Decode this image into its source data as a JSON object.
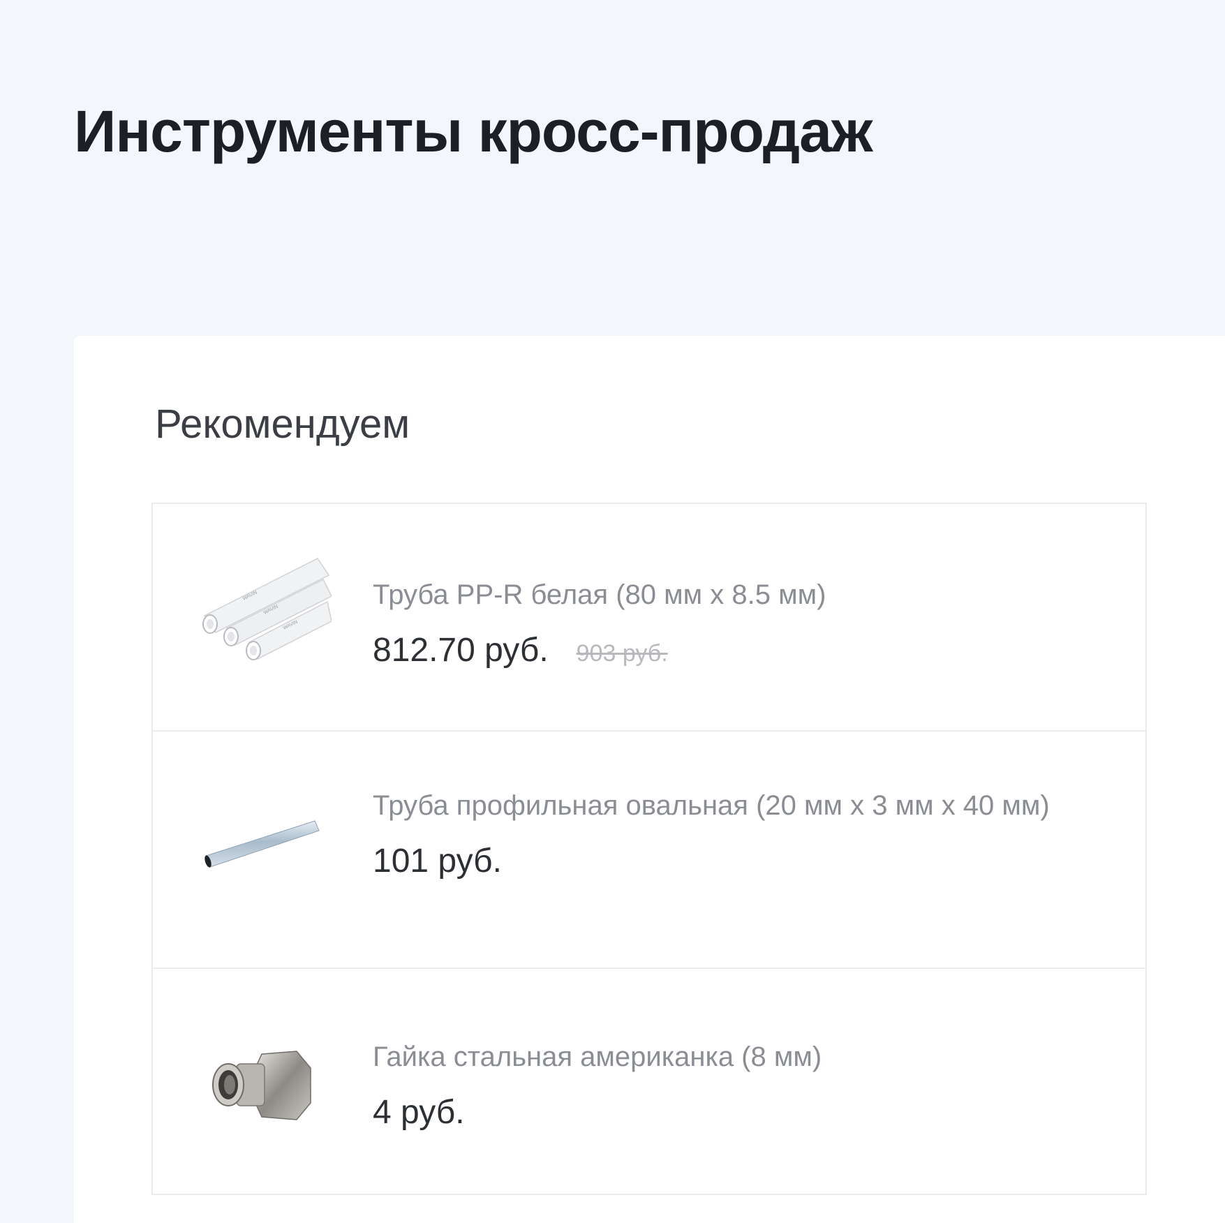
{
  "page": {
    "title": "Инструменты кросс-продаж"
  },
  "widget": {
    "heading": "Рекомендуем",
    "products": [
      {
        "name": "Труба PP-R белая (80 мм x 8.5 мм)",
        "price": "812.70 руб.",
        "old_price": "903 руб.",
        "image": "white-pipes-image"
      },
      {
        "name": "Труба профильная овальная (20 мм x 3 мм x 40 мм)",
        "price": "101 руб.",
        "old_price": null,
        "image": "oval-steel-pipe-image"
      },
      {
        "name": "Гайка стальная американка (8 мм)",
        "price": "4 руб.",
        "old_price": null,
        "image": "union-nut-image"
      }
    ]
  },
  "colors": {
    "background": "#f3f6fb",
    "panel": "#ffffff",
    "title": "#1d1f24",
    "product_name": "#8a8d93",
    "price": "#2c2f34",
    "old_price": "#b7b9bd",
    "border": "#e9ebef"
  }
}
